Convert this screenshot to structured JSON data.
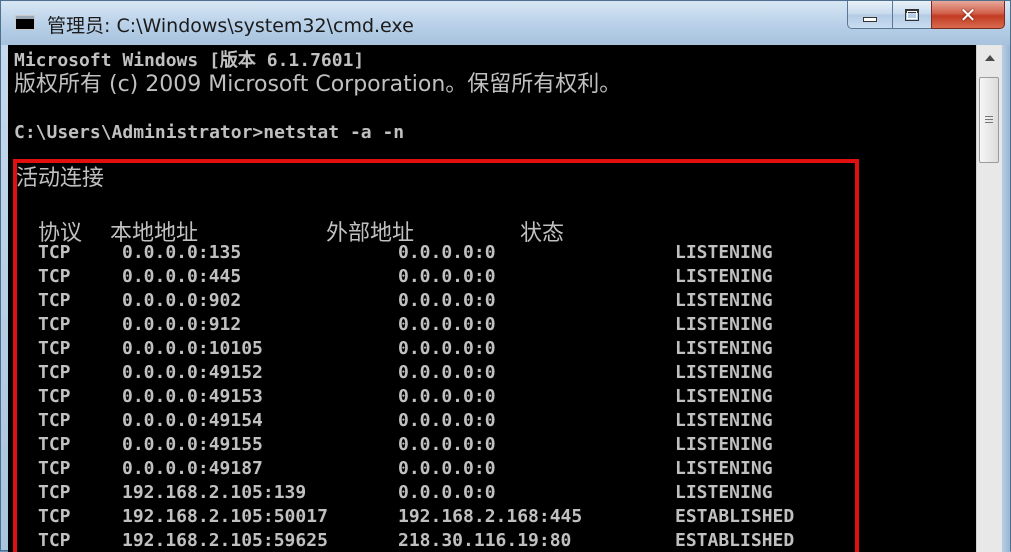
{
  "window": {
    "title": "管理员: C:\\Windows\\system32\\cmd.exe",
    "icon_label": "C:\\",
    "controls": {
      "minimize": "minimize",
      "maximize": "maximize",
      "close": "✕"
    }
  },
  "console": {
    "lines": [
      "Microsoft Windows [版本 6.1.7601]",
      "版权所有 (c) 2009 Microsoft Corporation。保留所有权利。",
      "",
      "C:\\Users\\Administrator>netstat -a -n"
    ],
    "section_title": "活动连接",
    "headers": {
      "proto": "协议",
      "local": "本地地址",
      "foreign": "外部地址",
      "state": "状态"
    },
    "rows": [
      {
        "proto": "TCP",
        "local": "0.0.0.0:135",
        "foreign": "0.0.0.0:0",
        "state": "LISTENING"
      },
      {
        "proto": "TCP",
        "local": "0.0.0.0:445",
        "foreign": "0.0.0.0:0",
        "state": "LISTENING"
      },
      {
        "proto": "TCP",
        "local": "0.0.0.0:902",
        "foreign": "0.0.0.0:0",
        "state": "LISTENING"
      },
      {
        "proto": "TCP",
        "local": "0.0.0.0:912",
        "foreign": "0.0.0.0:0",
        "state": "LISTENING"
      },
      {
        "proto": "TCP",
        "local": "0.0.0.0:10105",
        "foreign": "0.0.0.0:0",
        "state": "LISTENING"
      },
      {
        "proto": "TCP",
        "local": "0.0.0.0:49152",
        "foreign": "0.0.0.0:0",
        "state": "LISTENING"
      },
      {
        "proto": "TCP",
        "local": "0.0.0.0:49153",
        "foreign": "0.0.0.0:0",
        "state": "LISTENING"
      },
      {
        "proto": "TCP",
        "local": "0.0.0.0:49154",
        "foreign": "0.0.0.0:0",
        "state": "LISTENING"
      },
      {
        "proto": "TCP",
        "local": "0.0.0.0:49155",
        "foreign": "0.0.0.0:0",
        "state": "LISTENING"
      },
      {
        "proto": "TCP",
        "local": "0.0.0.0:49187",
        "foreign": "0.0.0.0:0",
        "state": "LISTENING"
      },
      {
        "proto": "TCP",
        "local": "192.168.2.105:139",
        "foreign": "0.0.0.0:0",
        "state": "LISTENING"
      },
      {
        "proto": "TCP",
        "local": "192.168.2.105:50017",
        "foreign": "192.168.2.168:445",
        "state": "ESTABLISHED"
      },
      {
        "proto": "TCP",
        "local": "192.168.2.105:59625",
        "foreign": "218.30.116.19:80",
        "state": "ESTABLISHED"
      }
    ]
  },
  "colors": {
    "console_bg": "#000000",
    "console_text": "#c0c0c0",
    "highlight_border": "#e01010"
  }
}
